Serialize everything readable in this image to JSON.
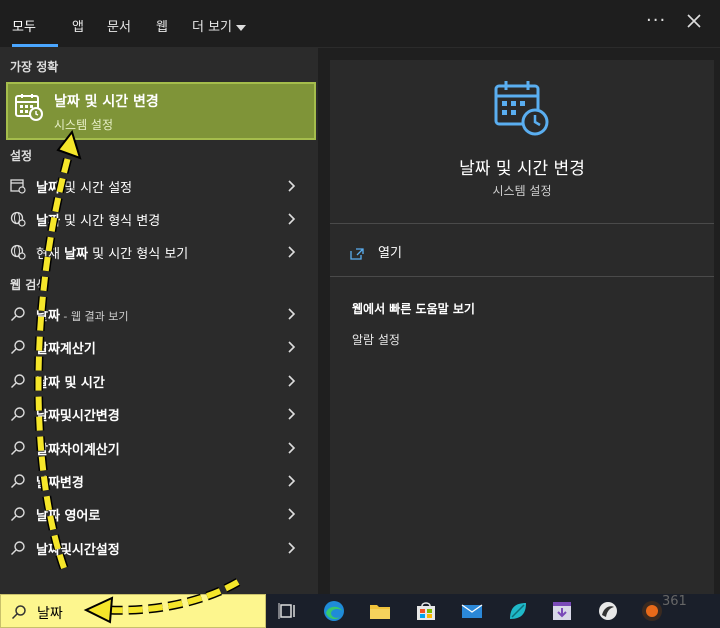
{
  "tabs": [
    {
      "label": "모두"
    },
    {
      "label": "앱"
    },
    {
      "label": "문서"
    },
    {
      "label": "웹"
    },
    {
      "label": "더 보기"
    }
  ],
  "left": {
    "best_match_label": "가장 정확",
    "best": {
      "title": "날짜 및 시간 변경",
      "subtitle": "시스템 설정",
      "icon": "calendar-clock-icon"
    },
    "settings_label": "설정",
    "settings_items": [
      {
        "pre": "",
        "bold": "날짜",
        "rest": " 및 시간 설정",
        "icon": "calendar-settings-icon"
      },
      {
        "pre": "",
        "bold": "날짜",
        "rest": " 및 시간 형식 변경",
        "icon": "globe-clock-icon"
      },
      {
        "pre": "현재 ",
        "bold": "날짜",
        "rest": " 및 시간 형식 보기",
        "icon": "globe-clock-icon"
      }
    ],
    "web_label": "웹 검색",
    "web_items": [
      {
        "pre": "",
        "bold": "날짜",
        "rest": "",
        "sub": " - 웹 결과 보기"
      },
      {
        "pre": "",
        "bold": "날짜계산기",
        "rest": "",
        "sub": ""
      },
      {
        "pre": "",
        "bold": "날짜 및 시간",
        "rest": "",
        "sub": ""
      },
      {
        "pre": "",
        "bold": "날짜및시간변경",
        "rest": "",
        "sub": ""
      },
      {
        "pre": "",
        "bold": "날짜차이계산기",
        "rest": "",
        "sub": ""
      },
      {
        "pre": "",
        "bold": "날짜변경",
        "rest": "",
        "sub": ""
      },
      {
        "pre": "",
        "bold": "날짜 영어로",
        "rest": "",
        "sub": ""
      },
      {
        "pre": "",
        "bold": "날짜및시간설정",
        "rest": "",
        "sub": ""
      }
    ]
  },
  "right": {
    "title": "날짜 및 시간 변경",
    "subtitle": "시스템 설정",
    "open_label": "열기",
    "web_help_title": "웹에서 빠른 도움말 보기",
    "web_help_link": "알람 설정"
  },
  "taskbar": {
    "search_value": "날짜",
    "tray_text": "361"
  },
  "colors": {
    "highlight": "#7f9438",
    "accent": "#4aa6ff",
    "search_bg": "#fdf68e",
    "annotation": "#f5e62a"
  }
}
